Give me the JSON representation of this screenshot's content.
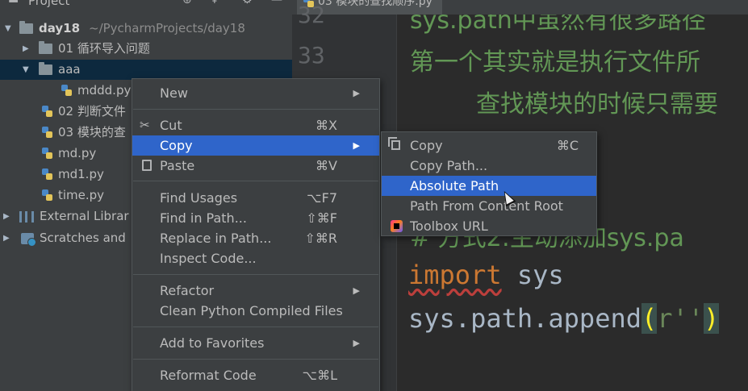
{
  "project_panel": {
    "title": "Project",
    "tree": [
      {
        "label": "day18",
        "path": "~/PycharmProjects/day18"
      },
      {
        "label": "01 循环导入问题"
      },
      {
        "label": "aaa"
      },
      {
        "label": "mddd.py"
      },
      {
        "label": "02 判断文件"
      },
      {
        "label": "03 模块的查"
      },
      {
        "label": "md.py"
      },
      {
        "label": "md1.py"
      },
      {
        "label": "time.py"
      },
      {
        "label": "External Librar"
      },
      {
        "label": "Scratches and"
      }
    ]
  },
  "editor": {
    "tab_label": "03 模块的查找顺序.py",
    "line_numbers": [
      "32",
      "33"
    ],
    "lines": {
      "l0": "sys.path中虽然有很多路径",
      "l1": "第一个其实就是执行文件所",
      "l2": "查找模块的时候只需要",
      "l3": "# 方式2:主动添加sys.pa",
      "kw_import": "import",
      "import_rest": " sys",
      "append_prefix": "sys.path.append",
      "paren_open": "(",
      "str": "r''",
      "paren_close": ")"
    }
  },
  "context_menu": {
    "items": [
      {
        "label": "New",
        "submenu": true
      },
      {
        "label": "Cut",
        "shortcut": "⌘X",
        "icon": "scissors-icon"
      },
      {
        "label": "Copy",
        "submenu": true,
        "highlighted": true
      },
      {
        "label": "Paste",
        "shortcut": "⌘V",
        "icon": "paste-icon"
      },
      {
        "label": "Find Usages",
        "shortcut": "⌥F7"
      },
      {
        "label": "Find in Path...",
        "shortcut": "⇧⌘F"
      },
      {
        "label": "Replace in Path...",
        "shortcut": "⇧⌘R"
      },
      {
        "label": "Inspect Code..."
      },
      {
        "label": "Refactor",
        "submenu": true
      },
      {
        "label": "Clean Python Compiled Files"
      },
      {
        "label": "Add to Favorites",
        "submenu": true
      },
      {
        "label": "Reformat Code",
        "shortcut": "⌥⌘L"
      }
    ]
  },
  "copy_submenu": {
    "items": [
      {
        "label": "Copy",
        "shortcut": "⌘C",
        "icon": "copy-icon"
      },
      {
        "label": "Copy Path..."
      },
      {
        "label": "Absolute Path",
        "highlighted": true
      },
      {
        "label": "Path From Content Root"
      },
      {
        "label": "Toolbox URL",
        "icon": "toolbox-icon"
      }
    ]
  },
  "colors": {
    "highlight": "#2f65ca",
    "panel_bg": "#3c3f41",
    "editor_bg": "#2b2b2b",
    "comment": "#629755",
    "keyword": "#cc7832"
  }
}
